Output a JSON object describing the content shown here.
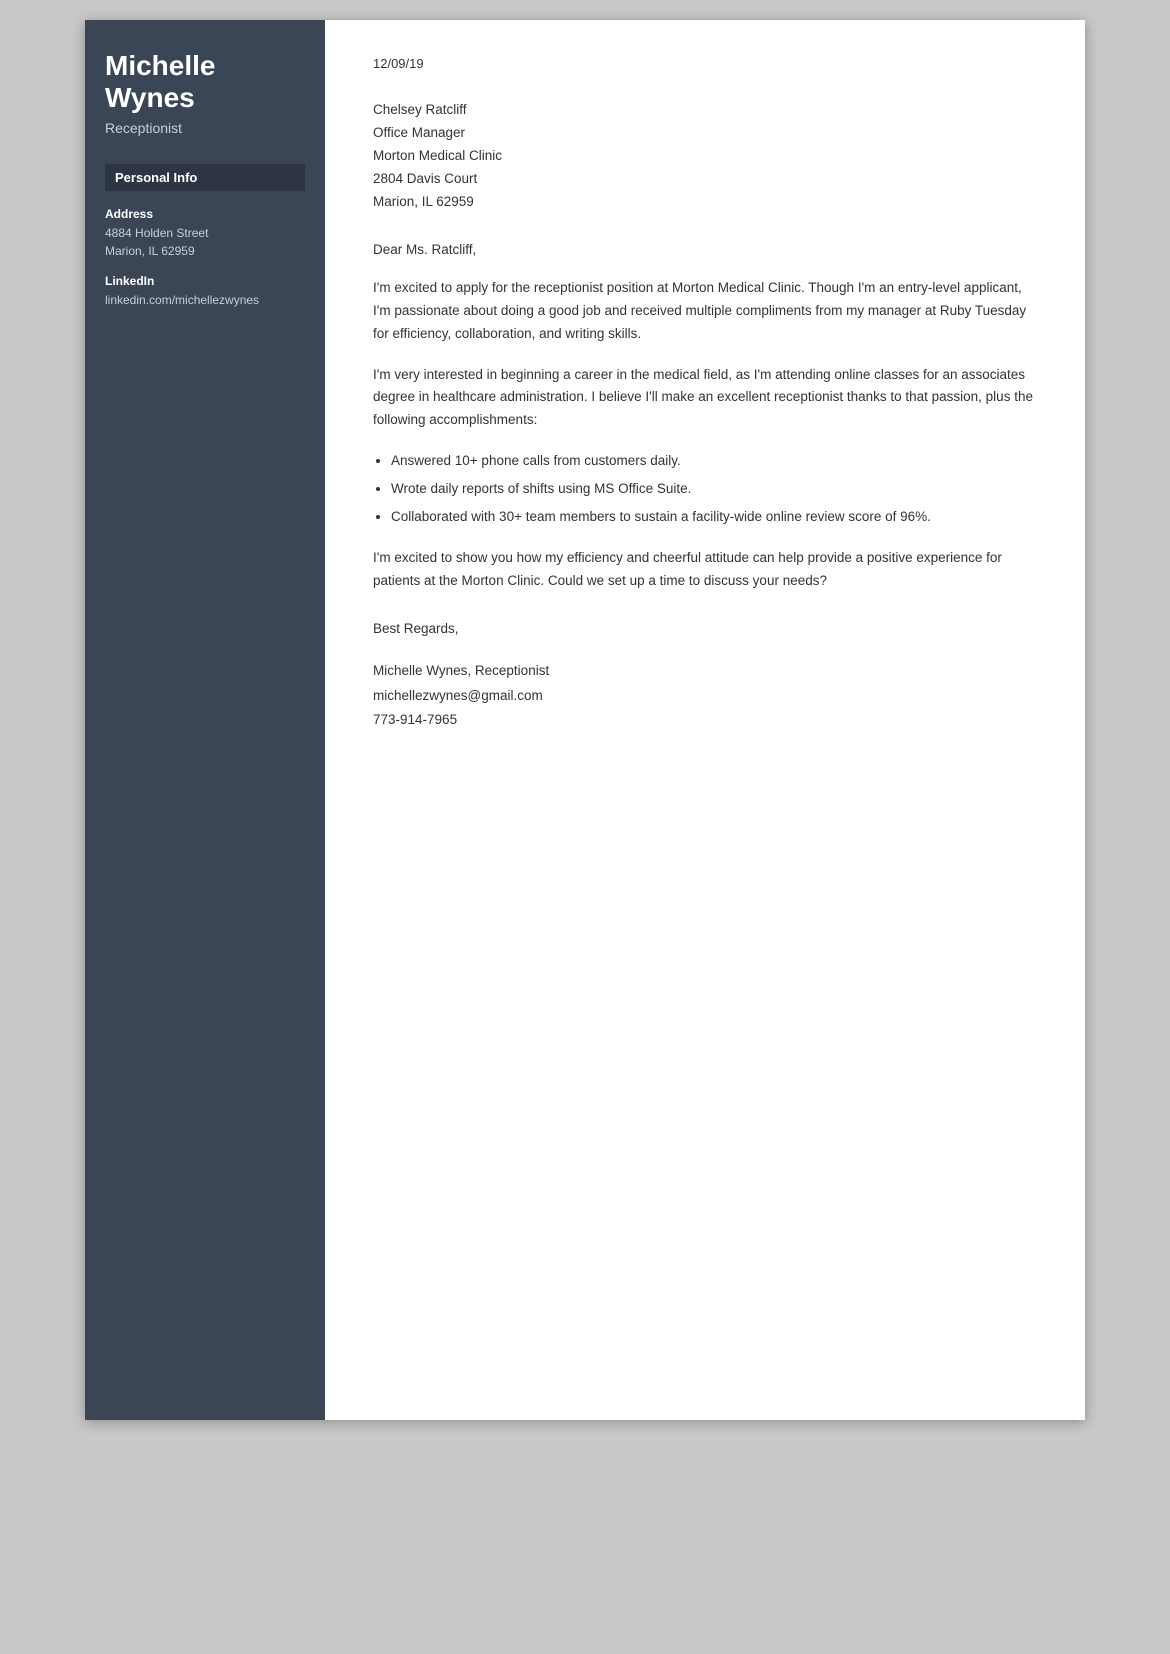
{
  "sidebar": {
    "name": "Michelle Wynes",
    "title": "Receptionist",
    "personal_info_heading": "Personal Info",
    "address_label": "Address",
    "address_line1": "4884 Holden Street",
    "address_line2": "Marion, IL 62959",
    "linkedin_label": "LinkedIn",
    "linkedin_value": "linkedin.com/michellezwynes"
  },
  "letter": {
    "date": "12/09/19",
    "recipient_name": "Chelsey Ratcliff",
    "recipient_title": "Office Manager",
    "recipient_company": "Morton Medical Clinic",
    "recipient_address1": "2804 Davis Court",
    "recipient_address2": "Marion, IL 62959",
    "salutation": "Dear Ms. Ratcliff,",
    "paragraph1": "I'm excited to apply for the receptionist position at Morton Medical Clinic. Though I'm an entry-level applicant, I'm passionate about doing a good job and received multiple compliments from my manager at Ruby Tuesday for efficiency, collaboration, and writing skills.",
    "paragraph2": "I'm very interested in beginning a career in the medical field, as I'm attending online classes for an associates degree in healthcare administration. I believe I'll make an excellent receptionist thanks to that passion, plus the following accomplishments:",
    "bullet1": "Answered 10+ phone calls from customers daily.",
    "bullet2": "Wrote daily reports of shifts using MS Office Suite.",
    "bullet3": "Collaborated with 30+ team members to sustain a facility-wide online review score of 96%.",
    "paragraph3": "I'm excited to show you how my efficiency and cheerful attitude can help provide a positive experience for patients at the Morton Clinic. Could we set up a time to discuss your needs?",
    "closing": "Best Regards,",
    "sign_name": "Michelle Wynes, Receptionist",
    "sign_email": "michellezwynes@gmail.com",
    "sign_phone": "773-914-7965"
  }
}
